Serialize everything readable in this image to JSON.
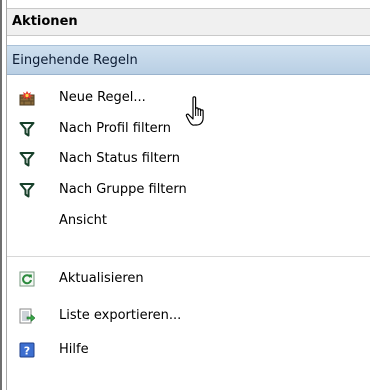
{
  "panel": {
    "title": "Aktionen",
    "group": "Eingehende Regeln"
  },
  "actions": [
    {
      "label": "Neue Regel...",
      "icon": "new-rule-icon"
    },
    {
      "label": "Nach Profil filtern",
      "icon": "filter-icon"
    },
    {
      "label": "Nach Status filtern",
      "icon": "filter-icon"
    },
    {
      "label": "Nach Gruppe filtern",
      "icon": "filter-icon"
    },
    {
      "label": "Ansicht",
      "icon": ""
    },
    {
      "label": "Aktualisieren",
      "icon": "refresh-icon"
    },
    {
      "label": "Liste exportieren...",
      "icon": "export-list-icon"
    },
    {
      "label": "Hilfe",
      "icon": "help-icon"
    }
  ],
  "colors": {
    "group_header_top": "#cfe0ef",
    "group_header_bottom": "#b9cfe4",
    "filter_icon": "#17402a"
  }
}
